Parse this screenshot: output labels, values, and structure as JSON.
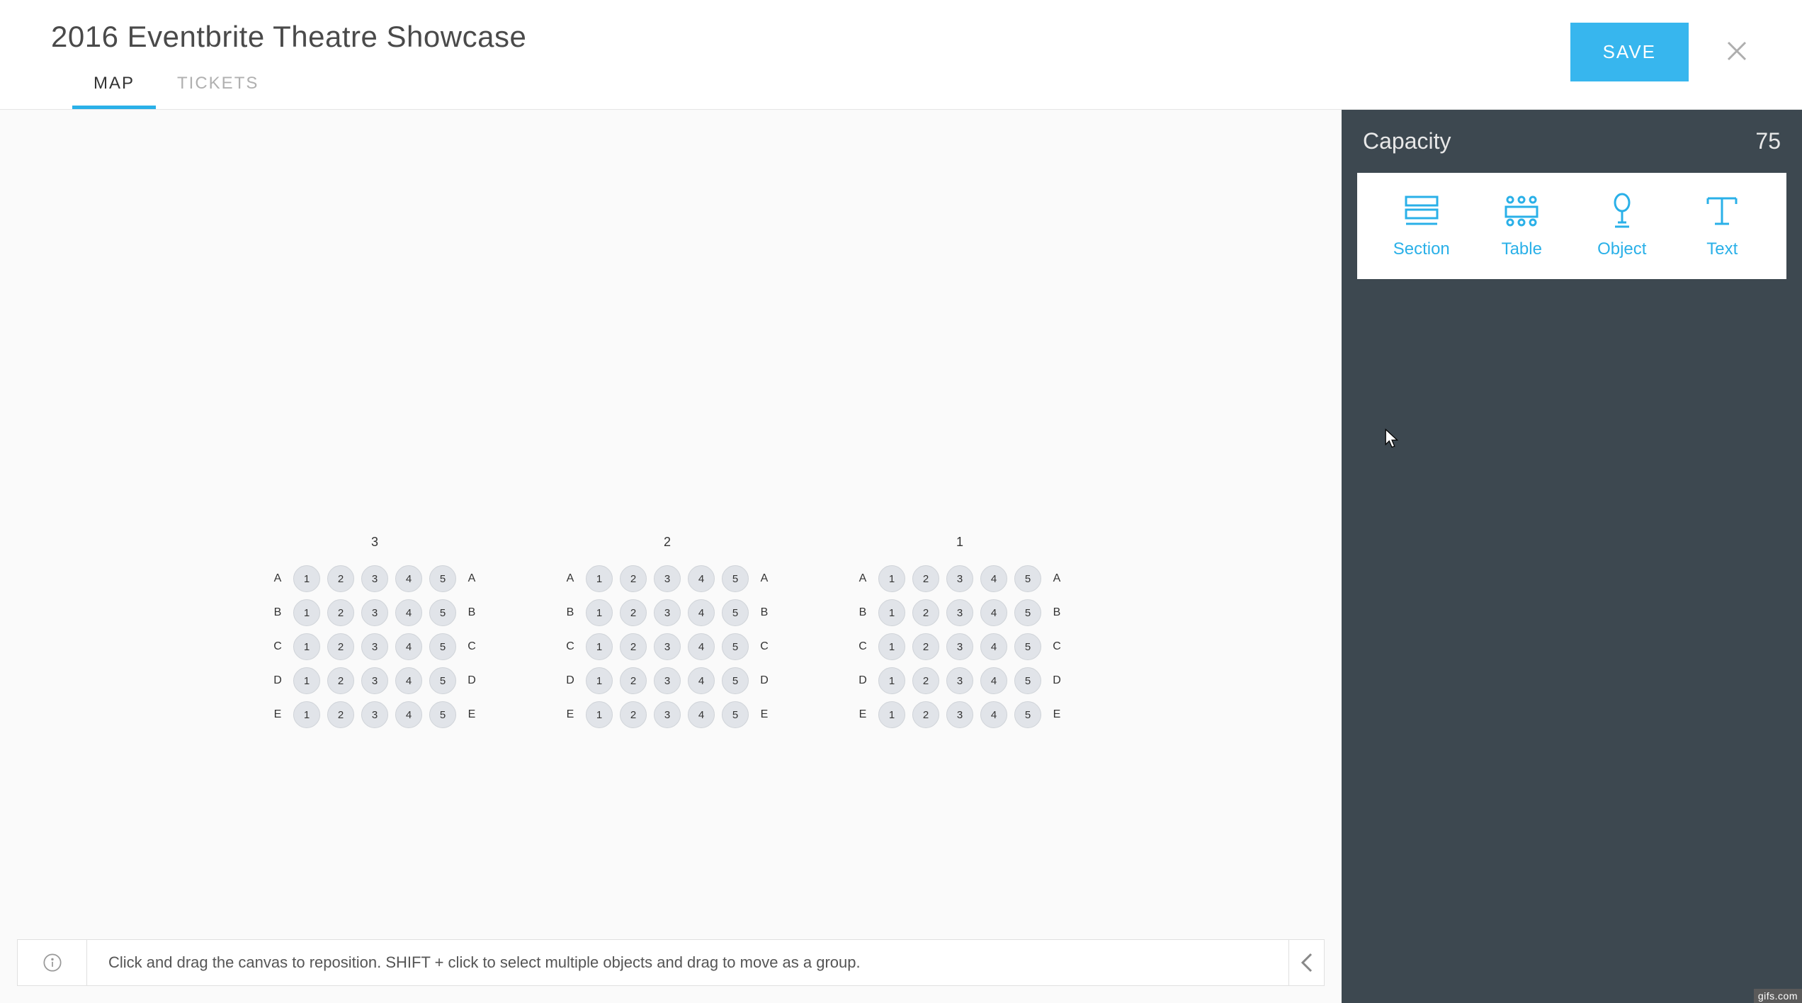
{
  "header": {
    "title": "2016 Eventbrite Theatre Showcase",
    "save_label": "SAVE",
    "tabs": [
      {
        "label": "MAP",
        "active": true
      },
      {
        "label": "TICKETS",
        "active": false
      }
    ]
  },
  "sidebar": {
    "capacity_label": "Capacity",
    "capacity_value": "75",
    "tools": [
      {
        "label": "Section"
      },
      {
        "label": "Table"
      },
      {
        "label": "Object"
      },
      {
        "label": "Text"
      }
    ]
  },
  "canvas": {
    "sections": [
      {
        "label": "3",
        "rows": [
          "A",
          "B",
          "C",
          "D",
          "E"
        ],
        "seats": [
          "1",
          "2",
          "3",
          "4",
          "5"
        ]
      },
      {
        "label": "2",
        "rows": [
          "A",
          "B",
          "C",
          "D",
          "E"
        ],
        "seats": [
          "1",
          "2",
          "3",
          "4",
          "5"
        ]
      },
      {
        "label": "1",
        "rows": [
          "A",
          "B",
          "C",
          "D",
          "E"
        ],
        "seats": [
          "1",
          "2",
          "3",
          "4",
          "5"
        ]
      }
    ],
    "hint": "Click and drag the canvas to reposition. SHIFT + click to select multiple objects and drag to move as a group."
  },
  "watermark": "gifs.com"
}
